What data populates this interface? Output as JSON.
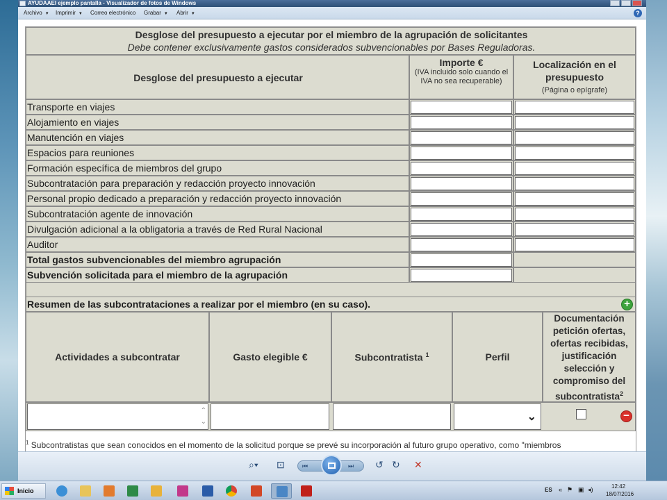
{
  "window": {
    "title": "AYUDAAEI ejemplo pantalla - Visualizador de fotos de Windows"
  },
  "menu": [
    "Archivo",
    "Imprimir",
    "Correo electrónico",
    "Grabar",
    "Abrir"
  ],
  "form": {
    "header_title": "Desglose del presupuesto a ejecutar por el miembro de la agrupación de solicitantes",
    "header_subtitle": "Debe contener exclusivamente gastos considerados subvencionables por Bases Reguladoras.",
    "col_desglose": "Desglose del presupuesto a ejecutar",
    "col_importe_title": "Importe €",
    "col_importe_note": "(IVA incluido solo cuando el IVA no sea recuperable)",
    "col_localizacion_title": "Localización en el presupuesto",
    "col_localizacion_note": "(Página o epígrafe)",
    "rows": [
      "Transporte en viajes",
      "Alojamiento en viajes",
      "Manutención en viajes",
      "Espacios para reuniones",
      "Formación específica de miembros del grupo",
      "Subcontratación para preparación y redacción proyecto innovación",
      "Personal propio dedicado a preparación y redacción proyecto innovación",
      "Subcontratación agente de innovación",
      "Divulgación adicional a la obligatoria a través de Red Rural Nacional",
      "Auditor"
    ],
    "total_label": "Total gastos subvencionables del miembro agrupación",
    "subvencion_label": "Subvención solicitada para el miembro de la agrupación",
    "resumen_title": "Resumen de las subcontrataciones a realizar por el miembro (en su caso).",
    "sub_cols": {
      "actividades": "Actividades a subcontratar",
      "gasto": "Gasto elegible €",
      "subcontratista": "Subcontratista",
      "subcontratista_sup": "1",
      "perfil": "Perfil",
      "documentacion": "Documentación petición ofertas, ofertas recibidas, justificación selección y compromiso del subcontratista",
      "documentacion_sup": "2"
    },
    "footnote_number": "1",
    "footnote_text": "Subcontratistas que sean conocidos en el momento de la solicitud porque se prevé su incorporación al futuro grupo operativo, como \"miembros"
  },
  "taskbar": {
    "start_label": "Inicio",
    "lang": "ES",
    "time": "12:42",
    "date": "18/07/2016"
  },
  "colors": {
    "gray_cell": "#dcdcd0",
    "add_icon": "#3da33d",
    "remove_icon": "#d9312b"
  }
}
